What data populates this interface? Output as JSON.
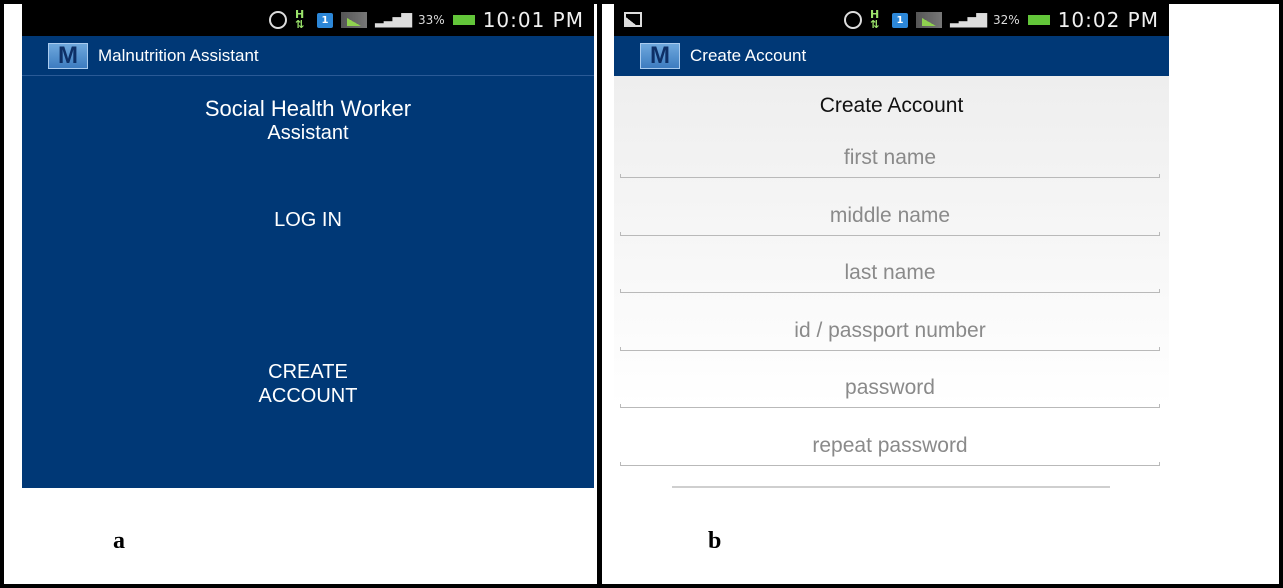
{
  "panel_a": {
    "status_bar": {
      "battery": "33%",
      "time": "10:01 PM"
    },
    "app_title": "Malnutrition Assistant",
    "logo_letter": "M",
    "heading_line1": "Social Health Worker",
    "heading_line2": "Assistant",
    "login_label": "LOG IN",
    "create_line1": "CREATE",
    "create_line2": "ACCOUNT",
    "caption": "a"
  },
  "panel_b": {
    "status_bar": {
      "battery": "32%",
      "time": "10:02 PM"
    },
    "app_title": "Create Account",
    "logo_letter": "M",
    "heading": "Create Account",
    "fields": {
      "first_name": "first name",
      "middle_name": "middle name",
      "last_name": "last name",
      "id_passport": "id / passport number",
      "password": "password",
      "repeat_password": "repeat password"
    },
    "caption": "b"
  },
  "colors": {
    "app_blue": "#003876",
    "status_black": "#000000",
    "battery_green": "#63c63a"
  },
  "icons": [
    "alarm-icon",
    "network-icon",
    "notification-icon",
    "wifi-icon",
    "signal-icon",
    "battery-icon",
    "image-icon"
  ]
}
